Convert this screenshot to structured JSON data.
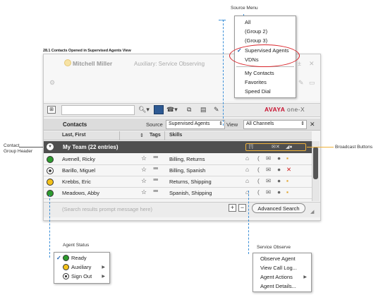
{
  "figure_title": "28.1 Contacts Opened in Supervised Agents View",
  "callouts": {
    "source_menu": "Source Menu",
    "contact_group_header": [
      "Contact",
      "Group Header"
    ],
    "broadcast_buttons": "Broadcast Buttons",
    "agent_status": "Agent Status",
    "service_observe": "Service Observe"
  },
  "background_window": {
    "agent_name": "Mitchell Miller",
    "state": "Auxiliary: Service Observing"
  },
  "toolbar": {
    "search_value": "",
    "brand": "AVAYA",
    "brand_suffix": "one-X"
  },
  "contacts_header": {
    "title": "Contacts",
    "source_label": "Source",
    "source_value": "Supervised Agents",
    "view_label": "View",
    "view_value": "All Channels"
  },
  "columns": {
    "name": "Last, First",
    "tags": "Tags",
    "skills": "Skills"
  },
  "group": {
    "label": "My Team (22 entries)"
  },
  "agents": [
    {
      "name": "Avenell, Ricky",
      "skills": "Billing, Returns",
      "status": "ready"
    },
    {
      "name": "Barillo, Miguel",
      "skills": "Billing, Spanish",
      "status": "out"
    },
    {
      "name": "Krebbs, Eric",
      "skills": "Returns, Shipping",
      "status": "aux"
    },
    {
      "name": "Meadows, Abby",
      "skills": "Spanish, Shipping",
      "status": "ready"
    }
  ],
  "footer": {
    "search_prompt": "(Search results prompt message here)",
    "advanced_search": "Advanced Search"
  },
  "source_menu": {
    "items": [
      "All",
      "(Group 2)",
      "(Group 3)",
      "Supervised Agents",
      "VDNs",
      "My Contacts",
      "Favorites",
      "Speed Dial"
    ],
    "checked": "Supervised Agents"
  },
  "status_menu": {
    "items": [
      "Ready",
      "Auxiliary",
      "Sign Out"
    ],
    "checked": "Ready"
  },
  "observe_menu": {
    "items": [
      "Observe Agent",
      "View Call Log...",
      "Agent Actions",
      "Agent Details..."
    ]
  },
  "colors": {
    "accent_brand": "#c8102e",
    "callout_leader": "#3a8fd8",
    "highlight": "#d9242a",
    "broadcast_outline": "#f0b33a",
    "ready": "#2d9b2d",
    "auxiliary": "#f4c21a"
  }
}
